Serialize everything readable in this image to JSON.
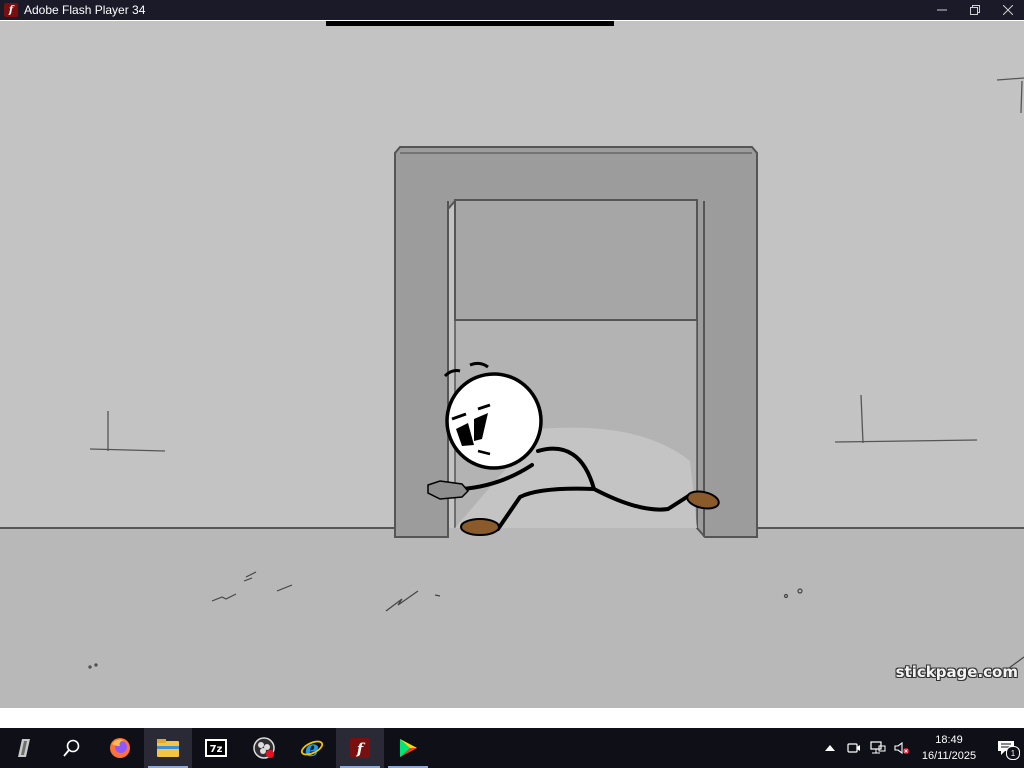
{
  "window": {
    "title": "Adobe Flash Player 34",
    "app_icon": "flash-player-icon",
    "controls": [
      "minimize-icon",
      "restore-icon",
      "close-icon"
    ]
  },
  "stage": {
    "scene": "stickman-crawling-under-doorway",
    "watermark": "stickpage.com",
    "colors": {
      "wall": "#c3c3c3",
      "floor": "#b8b8b8",
      "doorframe": "#9a9a9a",
      "ink": "#000000",
      "boots": "#8b5a2b"
    }
  },
  "taskbar": {
    "items": [
      {
        "icon": "start-icon",
        "running": false
      },
      {
        "icon": "search-icon",
        "running": false
      },
      {
        "icon": "firefox-icon",
        "running": false
      },
      {
        "icon": "file-explorer-icon",
        "running": true
      },
      {
        "icon": "7zip-icon",
        "running": false
      },
      {
        "icon": "obs-icon",
        "running": false
      },
      {
        "icon": "internet-explorer-icon",
        "running": false
      },
      {
        "icon": "flash-player-icon",
        "running": true
      },
      {
        "icon": "play-store-icon",
        "running": true
      }
    ],
    "tray": {
      "icons": [
        "show-hidden-icons-chevron-icon",
        "meet-now-icon",
        "network-icon",
        "volume-muted-icon"
      ],
      "time": "18:49",
      "date": "16/11/2025",
      "notification_count": "1"
    }
  }
}
